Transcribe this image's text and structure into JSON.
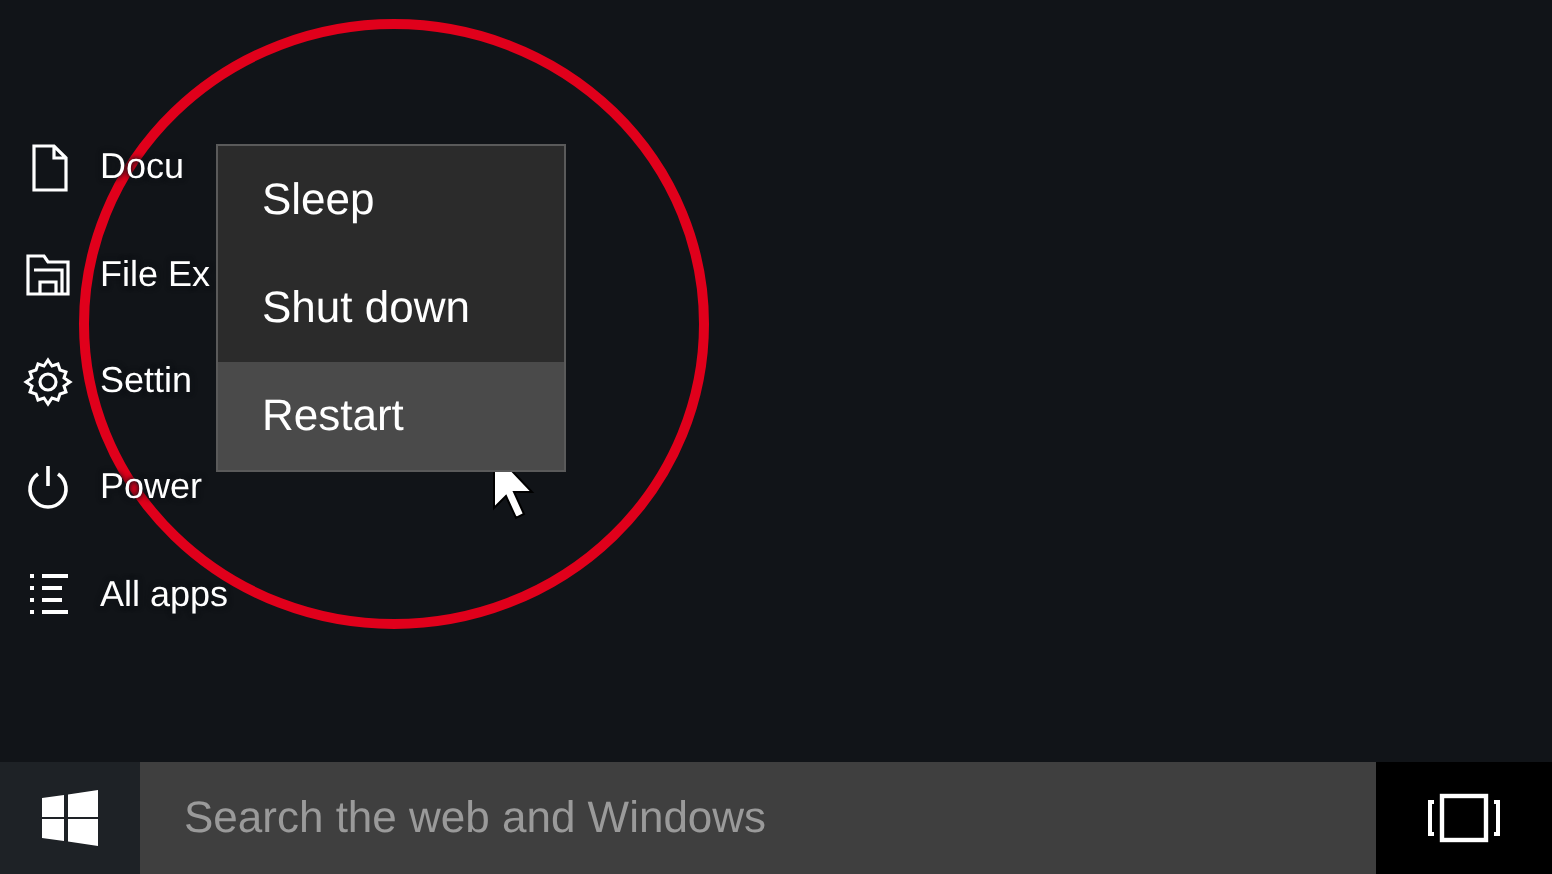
{
  "sidebar": {
    "items": [
      {
        "kind": "document",
        "label": "Docu"
      },
      {
        "kind": "folder",
        "label": "File Ex"
      },
      {
        "kind": "settings",
        "label": "Settin"
      },
      {
        "kind": "power",
        "label": "Power"
      },
      {
        "kind": "apps",
        "label": "All apps"
      }
    ]
  },
  "power_menu": {
    "items": [
      {
        "label": "Sleep",
        "selected": false
      },
      {
        "label": "Shut down",
        "selected": false
      },
      {
        "label": "Restart",
        "selected": true
      }
    ]
  },
  "taskbar": {
    "search": {
      "placeholder": "Search the web and Windows"
    }
  }
}
